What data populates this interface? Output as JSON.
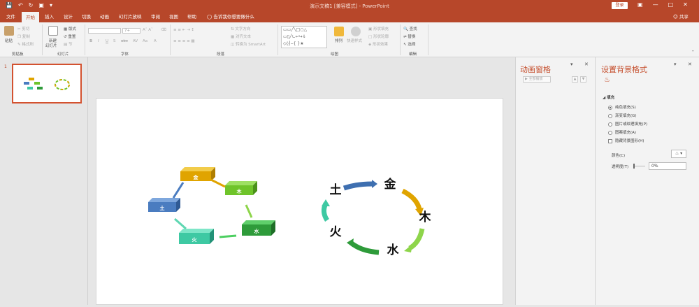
{
  "window": {
    "title": "演示文稿1 [兼容模式] - PowerPoint",
    "login_label": "登录",
    "share_label": "共享"
  },
  "tabs": [
    "文件",
    "开始",
    "插入",
    "设计",
    "切换",
    "动画",
    "幻灯片放映",
    "审阅",
    "视图",
    "帮助"
  ],
  "tell_me": "告诉我你想要做什么",
  "ribbon": {
    "clipboard": {
      "paste": "粘贴",
      "cut": "剪切",
      "copy": "复制",
      "format_painter": "格式刷",
      "label": "剪贴板"
    },
    "slides": {
      "new_slide": "新建",
      "new_slide_line2": "幻灯片",
      "layout": "版式",
      "reset": "重置",
      "section": "节",
      "label": "幻灯片"
    },
    "font": {
      "size": "7+",
      "label": "字体"
    },
    "paragraph": {
      "text_direction": "文字方向",
      "align_text": "对齐文本",
      "smartart": "转换为 SmartArt",
      "label": "段落"
    },
    "drawing": {
      "arrange": "排列",
      "quick_styles": "快速样式",
      "shape_fill": "形状填充",
      "shape_outline": "形状轮廓",
      "shape_effects": "形状效果",
      "label": "绘图"
    },
    "editing": {
      "find": "查找",
      "replace": "替换",
      "select": "选择",
      "label": "编辑"
    }
  },
  "thumbnail": {
    "number": "1"
  },
  "slide": {
    "box_labels": [
      "金",
      "木",
      "水",
      "火",
      "土"
    ],
    "cycle_labels": [
      "金",
      "木",
      "水",
      "火",
      "土"
    ]
  },
  "animation_pane": {
    "title": "动画窗格",
    "play_all": "全部播放"
  },
  "format_pane": {
    "title": "设置背景格式",
    "section": "填充",
    "options": [
      {
        "label": "纯色填充(S)",
        "selected": true
      },
      {
        "label": "渐变填充(G)",
        "selected": false
      },
      {
        "label": "图片或纹理填充(P)",
        "selected": false
      },
      {
        "label": "图案填充(A)",
        "selected": false
      }
    ],
    "hide_bg": "隐藏背景图形(H)",
    "color_label": "颜色(C)",
    "transparency_label": "透明度(T)",
    "transparency_value": "0%"
  },
  "colors": {
    "accent": "#b7472a",
    "gold": "#e0a400",
    "green_light": "#6fc42a",
    "green_dark": "#2e9b3a",
    "teal": "#3ec9a3",
    "blue": "#4a7cc0"
  }
}
